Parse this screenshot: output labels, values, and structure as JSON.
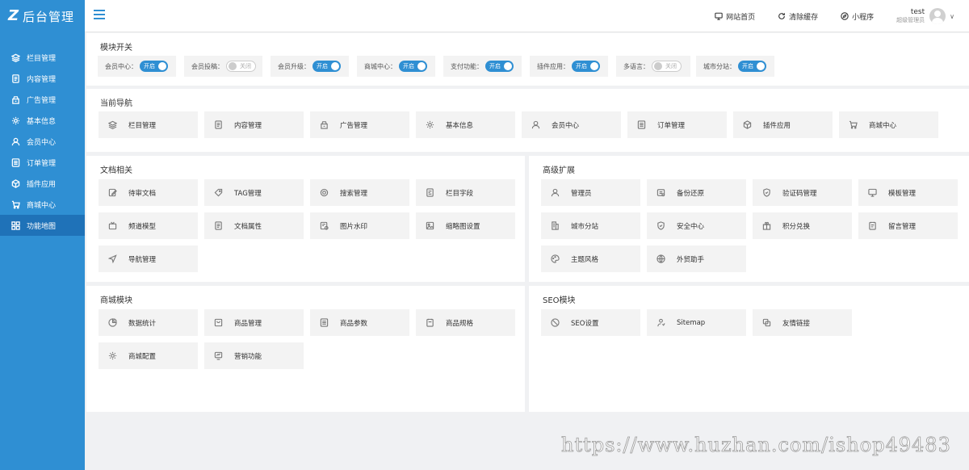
{
  "logo": {
    "mark": "Z",
    "text": "后台管理"
  },
  "sidebar": {
    "items": [
      {
        "label": "栏目管理",
        "icon": "layers-icon"
      },
      {
        "label": "内容管理",
        "icon": "document-icon"
      },
      {
        "label": "广告管理",
        "icon": "ad-icon"
      },
      {
        "label": "基本信息",
        "icon": "gear-icon"
      },
      {
        "label": "会员中心",
        "icon": "user-icon"
      },
      {
        "label": "订单管理",
        "icon": "list-icon"
      },
      {
        "label": "插件应用",
        "icon": "cube-icon"
      },
      {
        "label": "商城中心",
        "icon": "cart-icon"
      },
      {
        "label": "功能地图",
        "icon": "grid-icon"
      }
    ],
    "active_index": 8
  },
  "header": {
    "links": [
      {
        "label": "网站首页",
        "icon": "monitor-icon"
      },
      {
        "label": "清除缓存",
        "icon": "refresh-icon"
      },
      {
        "label": "小程序",
        "icon": "compass-icon"
      }
    ],
    "user": {
      "name": "test",
      "role": "超级管理员"
    }
  },
  "modules": {
    "title": "模块开关",
    "switches": [
      {
        "label": "会员中心：",
        "state": "开启",
        "on": true
      },
      {
        "label": "会员投稿：",
        "state": "关闭",
        "on": false
      },
      {
        "label": "会员升级：",
        "state": "开启",
        "on": true
      },
      {
        "label": "商城中心：",
        "state": "开启",
        "on": true
      },
      {
        "label": "支付功能：",
        "state": "开启",
        "on": true
      },
      {
        "label": "插件应用：",
        "state": "开启",
        "on": true
      },
      {
        "label": "多语言：",
        "state": "关闭",
        "on": false
      },
      {
        "label": "城市分站：",
        "state": "开启",
        "on": true
      }
    ]
  },
  "current_nav": {
    "title": "当前导航",
    "items": [
      {
        "label": "栏目管理",
        "icon": "layers-icon"
      },
      {
        "label": "内容管理",
        "icon": "document-icon"
      },
      {
        "label": "广告管理",
        "icon": "ad-icon"
      },
      {
        "label": "基本信息",
        "icon": "gear-icon"
      },
      {
        "label": "会员中心",
        "icon": "user-icon"
      },
      {
        "label": "订单管理",
        "icon": "list-icon"
      },
      {
        "label": "插件应用",
        "icon": "cube-icon"
      },
      {
        "label": "商城中心",
        "icon": "cart-icon"
      }
    ]
  },
  "docs": {
    "title": "文档相关",
    "items": [
      {
        "label": "待审文档",
        "icon": "edit-icon"
      },
      {
        "label": "TAG管理",
        "icon": "tag-icon"
      },
      {
        "label": "搜索管理",
        "icon": "search-icon"
      },
      {
        "label": "栏目字段",
        "icon": "field-icon"
      },
      {
        "label": "频道模型",
        "icon": "tv-icon"
      },
      {
        "label": "文档属性",
        "icon": "document-icon"
      },
      {
        "label": "图片水印",
        "icon": "watermark-icon"
      },
      {
        "label": "缩略图设置",
        "icon": "image-icon"
      },
      {
        "label": "导航管理",
        "icon": "navigation-icon"
      }
    ]
  },
  "advanced": {
    "title": "高级扩展",
    "items": [
      {
        "label": "管理员",
        "icon": "user-icon"
      },
      {
        "label": "备份还原",
        "icon": "backup-icon"
      },
      {
        "label": "验证码管理",
        "icon": "shield-icon"
      },
      {
        "label": "模板管理",
        "icon": "monitor-icon"
      },
      {
        "label": "城市分站",
        "icon": "building-icon"
      },
      {
        "label": "安全中心",
        "icon": "shield-icon"
      },
      {
        "label": "积分兑换",
        "icon": "gift-icon"
      },
      {
        "label": "留言管理",
        "icon": "message-icon"
      },
      {
        "label": "主题风格",
        "icon": "palette-icon"
      },
      {
        "label": "外贸助手",
        "icon": "globe-icon"
      }
    ]
  },
  "shop": {
    "title": "商城模块",
    "items": [
      {
        "label": "数据统计",
        "icon": "pie-icon"
      },
      {
        "label": "商品管理",
        "icon": "bag-icon"
      },
      {
        "label": "商品参数",
        "icon": "list-icon"
      },
      {
        "label": "商品规格",
        "icon": "spec-icon"
      },
      {
        "label": "商城配置",
        "icon": "gear-icon"
      },
      {
        "label": "营销功能",
        "icon": "marketing-icon"
      }
    ]
  },
  "seo": {
    "title": "SEO模块",
    "items": [
      {
        "label": "SEO设置",
        "icon": "seo-icon"
      },
      {
        "label": "Sitemap",
        "icon": "sitemap-icon"
      },
      {
        "label": "友情链接",
        "icon": "link-icon"
      }
    ]
  },
  "watermark": "https://www.huzhan.com/ishop49483"
}
